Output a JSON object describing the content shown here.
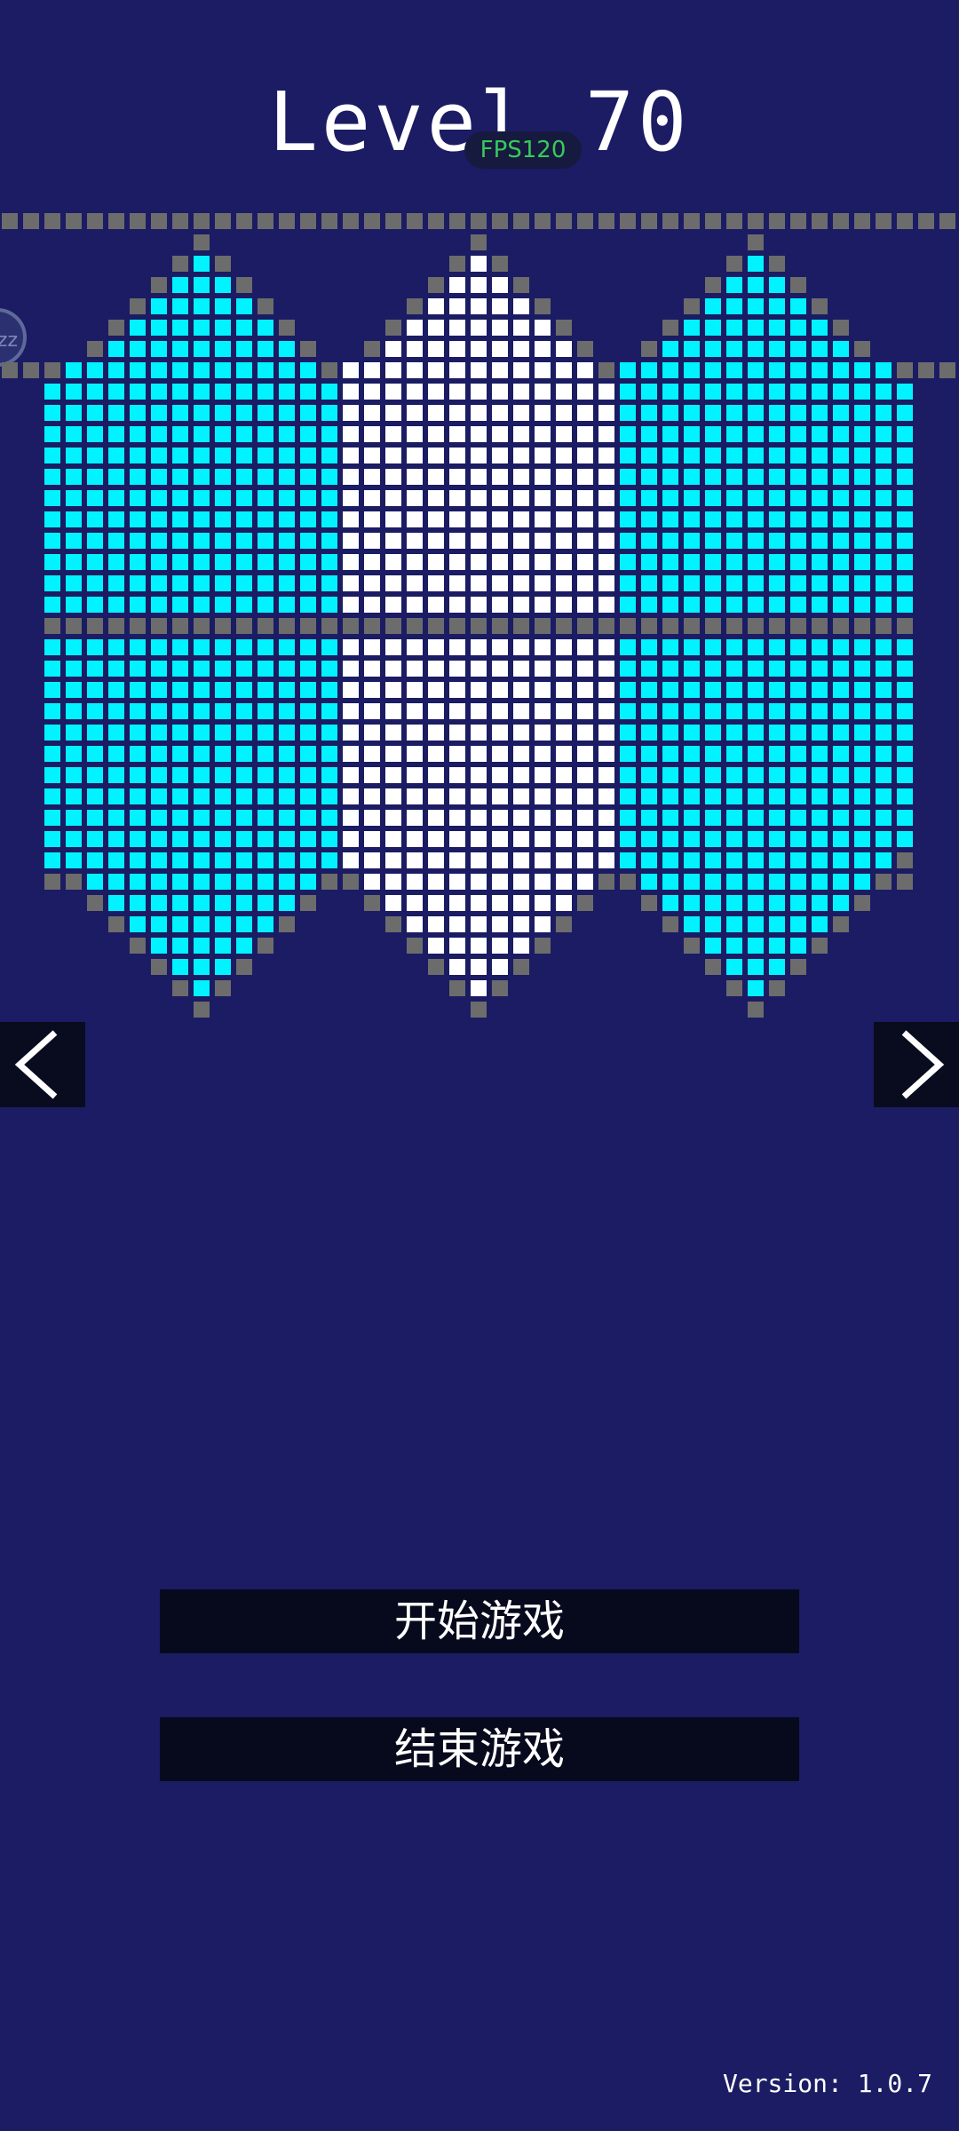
{
  "header": {
    "title": "Level 70",
    "fps_badge": "FPS120"
  },
  "floating_ball": {
    "label": "zz"
  },
  "menu": {
    "start_label": "开始游戏",
    "quit_label": "结束游戏"
  },
  "nav": {
    "prev_icon": "chevron-left-icon",
    "next_icon": "chevron-right-icon"
  },
  "footer": {
    "version": "Version: 1.0.7"
  },
  "colors": {
    "background": "#1b1c63",
    "cell_cyan": "#00f3ff",
    "cell_white": "#ffffff",
    "cell_gray": "#6c6c6c",
    "button_bg": "#070a1c",
    "fps_green": "#38c95c"
  },
  "puzzle": {
    "shapes": [
      {
        "name": "left-diamond",
        "color": "cyan"
      },
      {
        "name": "center-diamond",
        "color": "white"
      },
      {
        "name": "right-diamond",
        "color": "cyan"
      }
    ]
  }
}
